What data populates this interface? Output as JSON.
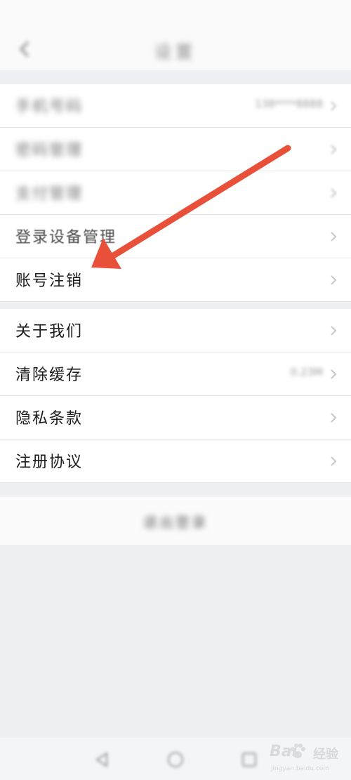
{
  "header": {
    "title": "设置",
    "back_icon": "back-arrow-icon"
  },
  "account_section": {
    "items": [
      {
        "label": "手机号码",
        "value": "138****8888"
      },
      {
        "label": "密码管理",
        "value": ""
      },
      {
        "label": "支付管理",
        "value": ""
      },
      {
        "label": "登录设备管理",
        "value": ""
      },
      {
        "label": "账号注销",
        "value": ""
      }
    ]
  },
  "info_section": {
    "items": [
      {
        "label": "关于我们",
        "value": ""
      },
      {
        "label": "清除缓存",
        "value": "0.23M"
      },
      {
        "label": "隐私条款",
        "value": ""
      },
      {
        "label": "注册协议",
        "value": ""
      }
    ]
  },
  "logout": {
    "label": "退出登录"
  },
  "nav_bar": {
    "icons": [
      "back-triangle-icon",
      "home-circle-icon",
      "recent-square-icon"
    ]
  },
  "watermark": {
    "brand": "Bai",
    "text": "经验",
    "url": "jingyan.baidu.com"
  },
  "annotation": {
    "color": "#e8503a"
  },
  "colors": {
    "page_background": "#eef0f4",
    "row_background": "#ffffff",
    "divider": "#e6e6e6"
  }
}
